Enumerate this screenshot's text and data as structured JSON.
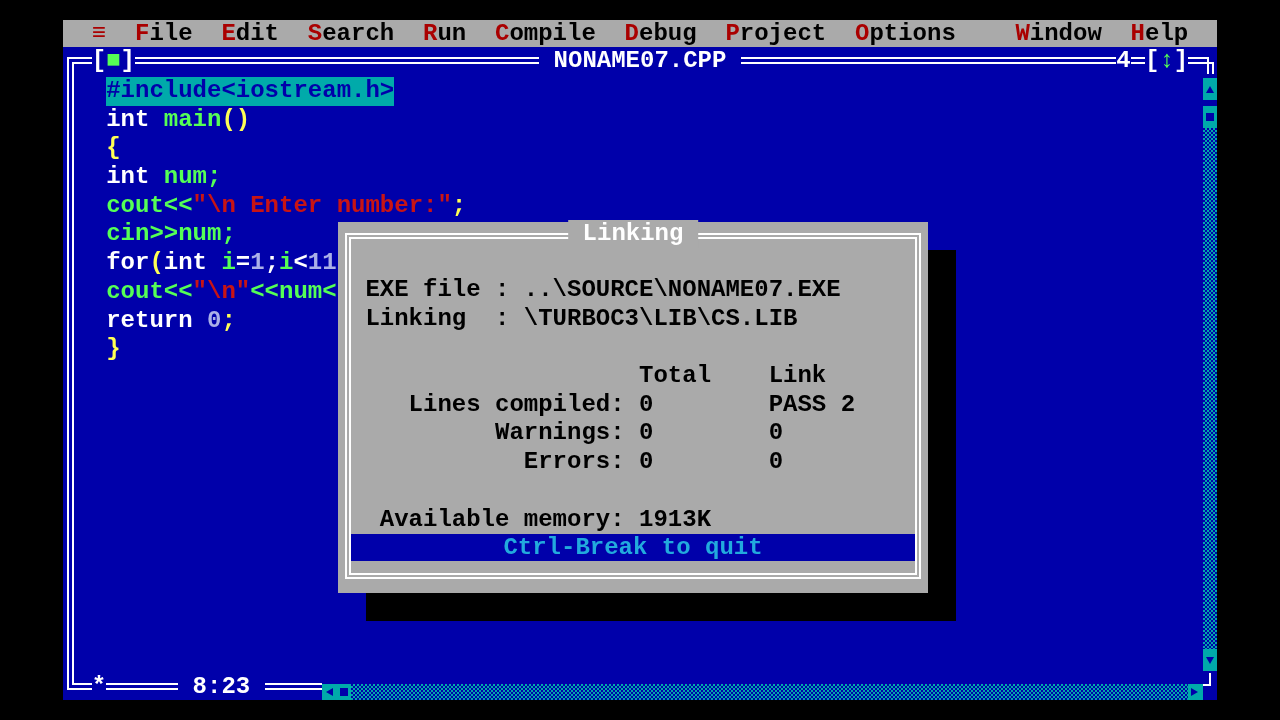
{
  "menu_bar": {
    "left_items": [
      "≡",
      "File",
      "Edit",
      "Search",
      "Run",
      "Compile",
      "Debug",
      "Project",
      "Options"
    ],
    "right_items": [
      "Window",
      "Help"
    ]
  },
  "editor": {
    "close_button": "[■]",
    "title": "NONAME07.CPP",
    "window_number": "4",
    "zoom_button": "[↕]",
    "lines": [
      {
        "selected": true,
        "tokens": [
          {
            "kind": "identifier",
            "text": "#include<iostream.h>"
          }
        ]
      },
      {
        "selected": false,
        "tokens": [
          {
            "kind": "plain",
            "text": "int "
          },
          {
            "kind": "identifier",
            "text": "main"
          },
          {
            "kind": "symbol",
            "text": "()"
          }
        ]
      },
      {
        "selected": false,
        "tokens": [
          {
            "kind": "symbol",
            "text": "{"
          }
        ]
      },
      {
        "selected": false,
        "tokens": [
          {
            "kind": "plain",
            "text": "int "
          },
          {
            "kind": "identifier",
            "text": "num;"
          }
        ]
      },
      {
        "selected": false,
        "tokens": [
          {
            "kind": "identifier",
            "text": "cout<<"
          },
          {
            "kind": "string",
            "text": "\"\\n Enter number:\""
          },
          {
            "kind": "symbol",
            "text": ";"
          }
        ]
      },
      {
        "selected": false,
        "tokens": [
          {
            "kind": "identifier",
            "text": "cin>>num;"
          }
        ]
      },
      {
        "selected": false,
        "tokens": [
          {
            "kind": "plain",
            "text": "for"
          },
          {
            "kind": "symbol",
            "text": "("
          },
          {
            "kind": "plain",
            "text": "int "
          },
          {
            "kind": "identifier",
            "text": "i"
          },
          {
            "kind": "plain",
            "text": "="
          },
          {
            "kind": "number",
            "text": "1"
          },
          {
            "kind": "plain",
            "text": ";"
          },
          {
            "kind": "identifier",
            "text": "i"
          },
          {
            "kind": "plain",
            "text": "<"
          },
          {
            "kind": "number",
            "text": "11"
          }
        ]
      },
      {
        "selected": false,
        "tokens": [
          {
            "kind": "identifier",
            "text": "cout<<"
          },
          {
            "kind": "string",
            "text": "\"\\n\""
          },
          {
            "kind": "identifier",
            "text": "<<num<"
          }
        ]
      },
      {
        "selected": false,
        "tokens": [
          {
            "kind": "plain",
            "text": "return "
          },
          {
            "kind": "number",
            "text": "0"
          },
          {
            "kind": "symbol",
            "text": ";"
          }
        ]
      },
      {
        "selected": false,
        "tokens": [
          {
            "kind": "symbol",
            "text": "}"
          }
        ]
      }
    ],
    "modified_marker": "*",
    "cursor_position": "8:23"
  },
  "dialog": {
    "title": "Linking",
    "info": [
      {
        "label": "EXE file",
        "separator": ":",
        "value": "..\\SOURCE\\NONAME07.EXE"
      },
      {
        "label": "Linking",
        "separator": ":",
        "value": "\\TURBOC3\\LIB\\CS.LIB"
      }
    ],
    "columns": [
      "Total",
      "Link"
    ],
    "stats": [
      {
        "label": "Lines compiled:",
        "total": "0",
        "link": "PASS 2"
      },
      {
        "label": "Warnings:",
        "total": "0",
        "link": "0"
      },
      {
        "label": "Errors:",
        "total": "0",
        "link": "0"
      }
    ],
    "memory": {
      "label": "Available memory:",
      "value": "1913K"
    },
    "footer": "Ctrl-Break to quit"
  }
}
